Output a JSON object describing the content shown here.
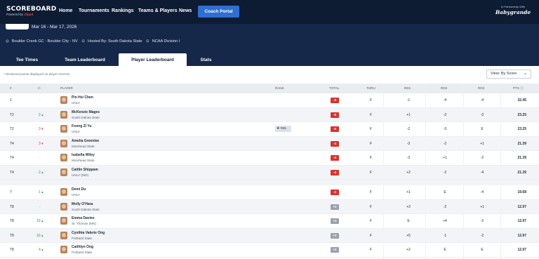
{
  "nav": {
    "logo_main": "SCOREBOARD",
    "logo_powered": "Powered by",
    "logo_brand": "clippd",
    "links": [
      "Home",
      "Tournaments",
      "Rankings",
      "Teams & Players",
      "News"
    ],
    "cta": "Coach Portal",
    "partner_caption": "In Partnership With",
    "partner_logo": "Babygrande"
  },
  "event": {
    "dates": "Mar 16 - Mar 17, 2026",
    "course": "Boulder Creek GC - Boulder City - NV",
    "host": "Hosted By: South Dakota State",
    "division": "NCAA Division I"
  },
  "tabs": [
    "Tee Times",
    "Team Leaderboard",
    "Player Leaderboard",
    "Stats"
  ],
  "active_tab": "Player Leaderboard",
  "note": "* Divisional points displayed on player screens",
  "view_select": "View: By Score",
  "columns": [
    "#",
    "+/-",
    "PLAYER",
    "RANK",
    "TOTAL",
    "THRU",
    "RD1",
    "RD2",
    "RD3",
    "PTS"
  ],
  "colors": {
    "nav_bg": "#0d1b33",
    "event_bg": "#15284a",
    "accent": "#2f6fd1",
    "under_par": "#d8342f",
    "over_par": "#9aa1ad",
    "move_up": "#2e9b4a",
    "move_down": "#d63a35"
  },
  "rows": [
    {
      "pos": "1",
      "move": "-",
      "dir": "none",
      "name": "Pin Hsi Chen",
      "school": "UNLV",
      "rank": "",
      "total": "-8",
      "total_style": "red",
      "thru": "F",
      "rd1": "-1",
      "rd2": "-4",
      "rd3": "-4",
      "pts": "32.45"
    },
    {
      "pos": "T2",
      "move": "2",
      "dir": "up",
      "name": "McKenzie Mages",
      "school": "South Dakota State",
      "rank": "",
      "total": "-5",
      "total_style": "red",
      "thru": "F",
      "rd1": "+1",
      "rd2": "-3",
      "rd3": "-3",
      "pts": "23.25"
    },
    {
      "pos": "T2",
      "move": "3",
      "dir": "down",
      "name": "Foong Zi Yu",
      "school": "UNLV",
      "rank": "#65",
      "total": "-5",
      "total_style": "red",
      "thru": "F",
      "rd1": "-2",
      "rd2": "-3",
      "rd3": "E",
      "pts": "23.25"
    },
    {
      "pos": "T4",
      "move": "3",
      "dir": "down",
      "name": "Amelia Greenlee",
      "school": "Morehead State",
      "rank": "",
      "total": "-4",
      "total_style": "red",
      "thru": "F",
      "rd1": "-3",
      "rd2": "-2",
      "rd3": "+1",
      "pts": "21.39"
    },
    {
      "pos": "T4",
      "move": "-",
      "dir": "none",
      "name": "Isabella Wiley",
      "school": "Morehead State",
      "rank": "",
      "total": "-4",
      "total_style": "red",
      "thru": "F",
      "rd1": "-3",
      "rd2": "+1",
      "rd3": "-2",
      "pts": "21.39"
    },
    {
      "pos": "T4",
      "move": "2",
      "dir": "up",
      "name": "Caitlin Shippam",
      "school": "UNLV (IND)",
      "rank": "",
      "total": "-4",
      "total_style": "red",
      "thru": "F",
      "rd1": "+2",
      "rd2": "-2",
      "rd3": "-4",
      "pts": "21.39"
    },
    {
      "pos": "7",
      "move": "1",
      "dir": "up",
      "name": "Demi Du",
      "school": "UNLV",
      "rank": "",
      "total": "-3",
      "total_style": "red",
      "thru": "F",
      "rd1": "+1",
      "rd2": "E",
      "rd3": "-4",
      "pts": "19.68"
    },
    {
      "pos": "T8",
      "move": "-",
      "dir": "none",
      "name": "Molly O'Hara",
      "school": "South Dakota State",
      "rank": "",
      "total": "+2",
      "total_style": "grey",
      "thru": "F",
      "rd1": "+3",
      "rd2": "-2",
      "rd3": "+1",
      "pts": "12.97"
    },
    {
      "pos": "T8",
      "move": "10",
      "dir": "up",
      "name": "Emma Davies",
      "school": "St. Thomas (MN)",
      "rank": "",
      "total": "+2",
      "total_style": "grey",
      "thru": "F",
      "rd1": "E",
      "rd2": "+4",
      "rd3": "-2",
      "pts": "12.97"
    },
    {
      "pos": "T8",
      "move": "10",
      "dir": "up",
      "name": "Cynthia Valerie Ong",
      "school": "Portland State",
      "rank": "",
      "total": "+2",
      "total_style": "grey",
      "thru": "F",
      "rd1": "+5",
      "rd2": "-1",
      "rd3": "-2",
      "pts": "12.97"
    },
    {
      "pos": "T8",
      "move": "4",
      "dir": "up",
      "name": "Caithlyn Ong",
      "school": "Portland State",
      "rank": "",
      "total": "+2",
      "total_style": "grey",
      "thru": "F",
      "rd1": "+2",
      "rd2": "E",
      "rd3": "E",
      "pts": "12.97"
    }
  ]
}
